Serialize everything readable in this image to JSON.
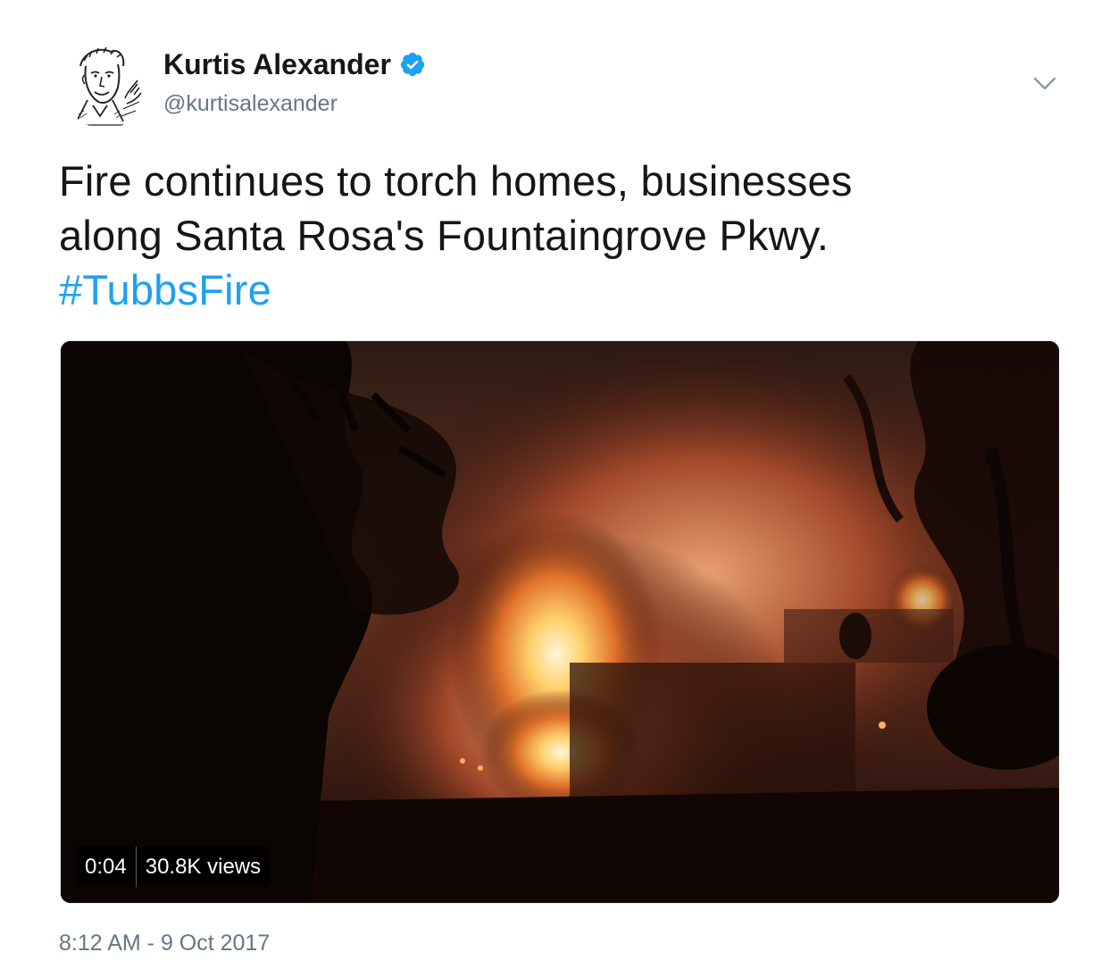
{
  "author": {
    "display_name": "Kurtis Alexander",
    "handle": "@kurtisalexander",
    "verified": true,
    "verified_color": "#1da1f2"
  },
  "tweet": {
    "text_line_1": "Fire continues to torch homes, businesses",
    "text_line_2": "along Santa Rosa's Fountaingrove Pkwy.",
    "hashtag": "#TubbsFire",
    "hashtag_color": "#1da1f2"
  },
  "media": {
    "type": "video",
    "duration": "0:04",
    "views": "30.8K views"
  },
  "timestamp": "8:12 AM - 9 Oct 2017",
  "icons": {
    "avatar": "sketch-portrait-avatar",
    "verified": "verified-badge-icon",
    "menu": "chevron-down-icon"
  },
  "colors": {
    "text_primary": "#14171a",
    "text_secondary": "#657786",
    "border": "#e1e8ed"
  }
}
